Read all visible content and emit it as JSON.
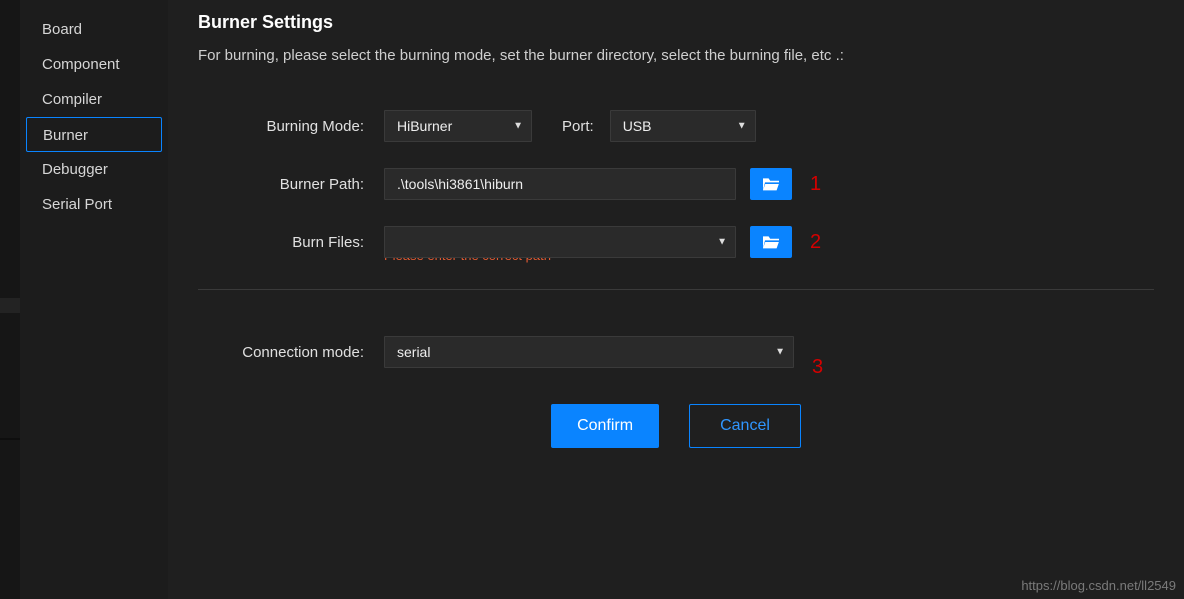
{
  "sidebar": {
    "items": [
      {
        "label": "Board"
      },
      {
        "label": "Component"
      },
      {
        "label": "Compiler"
      },
      {
        "label": "Burner"
      },
      {
        "label": "Debugger"
      },
      {
        "label": "Serial Port"
      }
    ],
    "selected_index": 3
  },
  "header": {
    "title": "Burner Settings",
    "description": "For burning, please select the burning mode, set the burner directory, select the burning file, etc .:"
  },
  "form": {
    "burning_mode": {
      "label": "Burning Mode:",
      "value": "HiBurner"
    },
    "port": {
      "label": "Port:",
      "value": "USB"
    },
    "burner_path": {
      "label": "Burner Path:",
      "value": ".\\tools\\hi3861\\hiburn"
    },
    "burn_files": {
      "label": "Burn Files:",
      "value": "",
      "error": "Please enter the correct path"
    },
    "connection_mode": {
      "label": "Connection mode:",
      "value": "serial"
    }
  },
  "buttons": {
    "confirm": "Confirm",
    "cancel": "Cancel"
  },
  "annotations": {
    "a1": "1",
    "a2": "2",
    "a3": "3"
  },
  "watermark": "https://blog.csdn.net/ll2549",
  "colors": {
    "accent": "#0a84ff",
    "error": "#e05a33",
    "anno": "#d40000"
  }
}
